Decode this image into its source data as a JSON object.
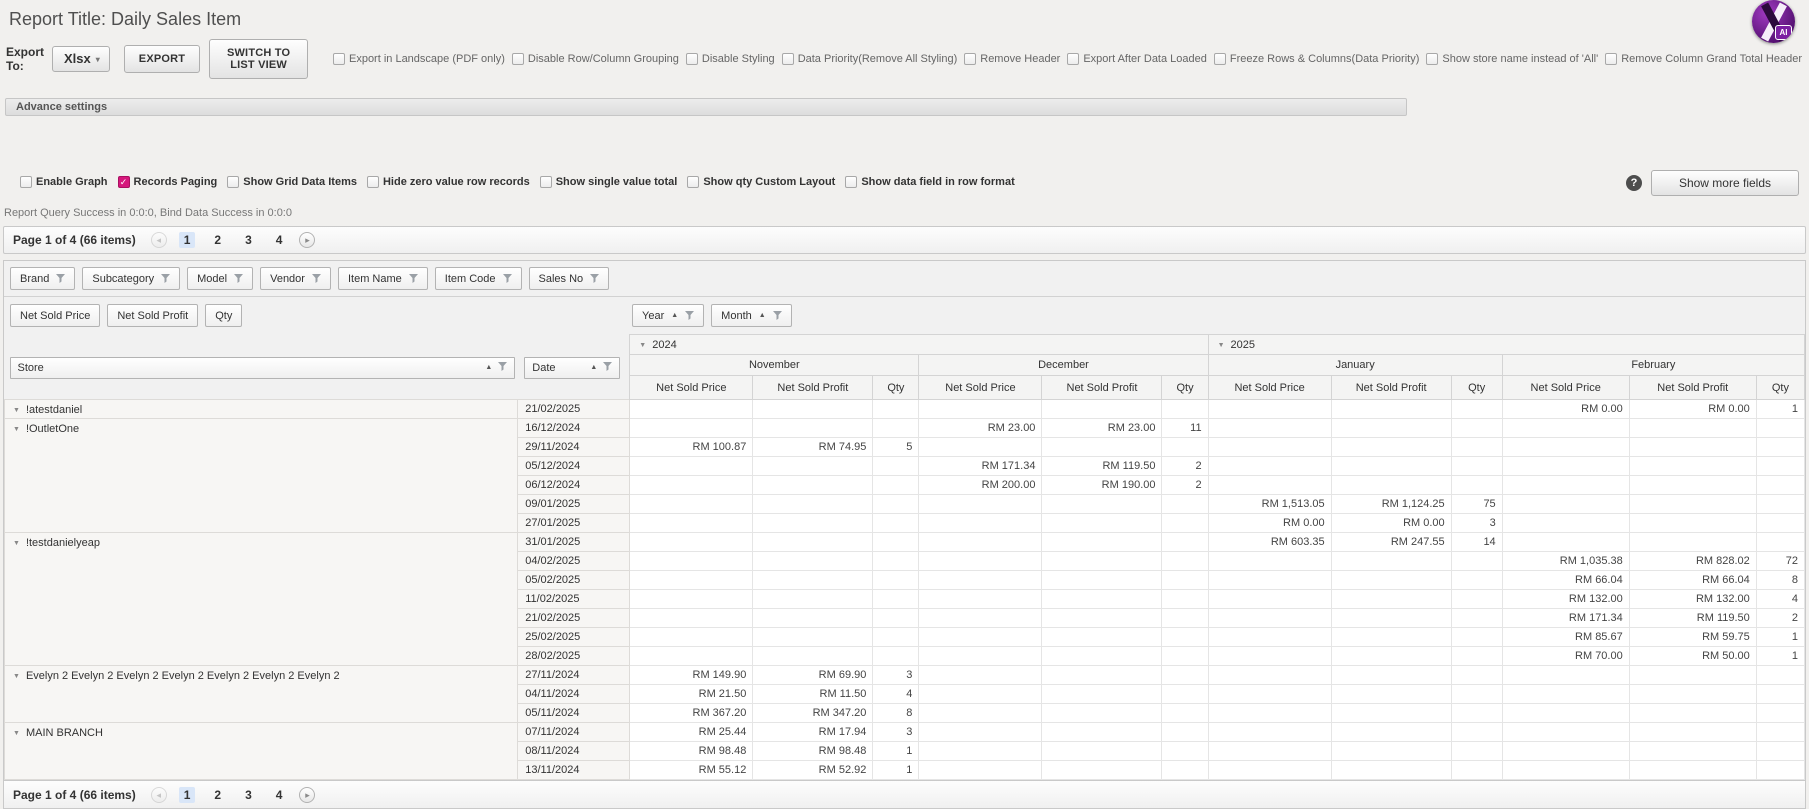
{
  "colors": {
    "accent_checkbox": "#d6177c",
    "selected_page_bg": "#d9e6f8",
    "logo_purple": "#6a1b9a"
  },
  "icons": {
    "help": "?",
    "sort_asc": "▲",
    "expand": "▼",
    "prev": "◂",
    "next": "▸",
    "check": "✓",
    "dropdown": "▾"
  },
  "header": {
    "title": "Report Title: Daily Sales Item",
    "export_to_label": "Export To:",
    "format_value": "Xlsx",
    "export_button": "EXPORT",
    "switch_view_button": "SWITCH TO LIST VIEW",
    "logo_label": "AI",
    "export_options": [
      "Export in Landscape (PDF only)",
      "Disable Row/Column Grouping",
      "Disable Styling",
      "Data Priority(Remove All Styling)",
      "Remove Header",
      "Export After Data Loaded",
      "Freeze Rows & Columns(Data Priority)",
      "Show store name instead of 'All'",
      "Remove Column Grand Total Header"
    ]
  },
  "advance_settings_label": "Advance settings",
  "display_options": [
    {
      "label": "Enable Graph",
      "checked": false
    },
    {
      "label": "Records Paging",
      "checked": true
    },
    {
      "label": "Show Grid Data Items",
      "checked": false
    },
    {
      "label": "Hide zero value row records",
      "checked": false
    },
    {
      "label": "Show single value total",
      "checked": false
    },
    {
      "label": "Show qty Custom Layout",
      "checked": false
    },
    {
      "label": "Show data field in row format",
      "checked": false
    }
  ],
  "show_more_fields_button": "Show more fields",
  "status_text": "Report Query Success in 0:0:0, Bind Data Success in 0:0:0",
  "pager": {
    "summary": "Page 1 of 4 (66 items)",
    "pages": [
      "1",
      "2",
      "3",
      "4"
    ],
    "current_page": "1"
  },
  "pivot": {
    "filter_fields": [
      "Brand",
      "Subcategory",
      "Model",
      "Vendor",
      "Item Name",
      "Item Code",
      "Sales No"
    ],
    "data_fields": [
      "Net Sold Price",
      "Net Sold Profit",
      "Qty"
    ],
    "column_fields": [
      "Year",
      "Month"
    ],
    "row_field": "Store",
    "row_field2": "Date",
    "column_groups": [
      {
        "year": "2024",
        "months": [
          "November",
          "December"
        ]
      },
      {
        "year": "2025",
        "months": [
          "January",
          "February"
        ]
      }
    ],
    "measure_labels": [
      "Net Sold Price",
      "Net Sold Profit",
      "Qty"
    ],
    "month_keys": [
      "nov",
      "dec",
      "jan",
      "feb"
    ],
    "row_groups": [
      {
        "store": "!atestdaniel",
        "row_count": 1
      },
      {
        "store": "!OutletOne",
        "row_count": 6
      },
      {
        "store": "!testdanielyeap",
        "row_count": 7
      },
      {
        "store": "Evelyn 2 Evelyn 2 Evelyn 2 Evelyn 2 Evelyn 2 Evelyn 2 Evelyn 2",
        "row_count": 3
      },
      {
        "store": "MAIN BRANCH",
        "row_count": 3
      }
    ],
    "rows": [
      {
        "date": "21/02/2025",
        "month": "feb",
        "values": [
          "RM 0.00",
          "RM 0.00",
          "1"
        ]
      },
      {
        "date": "16/12/2024",
        "month": "dec",
        "values": [
          "RM 23.00",
          "RM 23.00",
          "11"
        ]
      },
      {
        "date": "29/11/2024",
        "month": "nov",
        "values": [
          "RM 100.87",
          "RM 74.95",
          "5"
        ]
      },
      {
        "date": "05/12/2024",
        "month": "dec",
        "values": [
          "RM 171.34",
          "RM 119.50",
          "2"
        ]
      },
      {
        "date": "06/12/2024",
        "month": "dec",
        "values": [
          "RM 200.00",
          "RM 190.00",
          "2"
        ]
      },
      {
        "date": "09/01/2025",
        "month": "jan",
        "values": [
          "RM 1,513.05",
          "RM 1,124.25",
          "75"
        ]
      },
      {
        "date": "27/01/2025",
        "month": "jan",
        "values": [
          "RM 0.00",
          "RM 0.00",
          "3"
        ]
      },
      {
        "date": "31/01/2025",
        "month": "jan",
        "values": [
          "RM 603.35",
          "RM 247.55",
          "14"
        ]
      },
      {
        "date": "04/02/2025",
        "month": "feb",
        "values": [
          "RM 1,035.38",
          "RM 828.02",
          "72"
        ]
      },
      {
        "date": "05/02/2025",
        "month": "feb",
        "values": [
          "RM 66.04",
          "RM 66.04",
          "8"
        ]
      },
      {
        "date": "11/02/2025",
        "month": "feb",
        "values": [
          "RM 132.00",
          "RM 132.00",
          "4"
        ]
      },
      {
        "date": "21/02/2025",
        "month": "feb",
        "values": [
          "RM 171.34",
          "RM 119.50",
          "2"
        ]
      },
      {
        "date": "25/02/2025",
        "month": "feb",
        "values": [
          "RM 85.67",
          "RM 59.75",
          "1"
        ]
      },
      {
        "date": "28/02/2025",
        "month": "feb",
        "values": [
          "RM 70.00",
          "RM 50.00",
          "1"
        ]
      },
      {
        "date": "27/11/2024",
        "month": "nov",
        "values": [
          "RM 149.90",
          "RM 69.90",
          "3"
        ]
      },
      {
        "date": "04/11/2024",
        "month": "nov",
        "values": [
          "RM 21.50",
          "RM 11.50",
          "4"
        ]
      },
      {
        "date": "05/11/2024",
        "month": "nov",
        "values": [
          "RM 367.20",
          "RM 347.20",
          "8"
        ]
      },
      {
        "date": "07/11/2024",
        "month": "nov",
        "values": [
          "RM 25.44",
          "RM 17.94",
          "3"
        ]
      },
      {
        "date": "08/11/2024",
        "month": "nov",
        "values": [
          "RM 98.48",
          "RM 98.48",
          "1"
        ]
      },
      {
        "date": "13/11/2024",
        "month": "nov",
        "values": [
          "RM 55.12",
          "RM 52.92",
          "1"
        ]
      }
    ]
  }
}
